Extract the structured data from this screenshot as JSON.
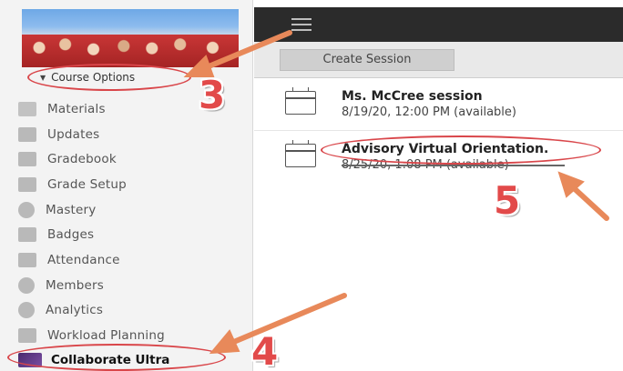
{
  "sidebar": {
    "course_options_label": "Course Options",
    "items": [
      {
        "label": "Materials",
        "icon": "materials-icon"
      },
      {
        "label": "Updates",
        "icon": "updates-icon"
      },
      {
        "label": "Gradebook",
        "icon": "gradebook-icon"
      },
      {
        "label": "Grade Setup",
        "icon": "grade-setup-icon"
      },
      {
        "label": "Mastery",
        "icon": "mastery-icon"
      },
      {
        "label": "Badges",
        "icon": "badges-icon"
      },
      {
        "label": "Attendance",
        "icon": "attendance-icon"
      },
      {
        "label": "Members",
        "icon": "members-icon"
      },
      {
        "label": "Analytics",
        "icon": "analytics-icon"
      },
      {
        "label": "Workload Planning",
        "icon": "workload-planning-icon"
      }
    ],
    "collaborate_label": "Collaborate Ultra"
  },
  "toolbar": {
    "create_session_label": "Create Session"
  },
  "sessions": [
    {
      "name": "Ms. McCree session",
      "when": "8/19/20, 12:00 PM (available)"
    },
    {
      "name": "Advisory Virtual Orientation.",
      "when": "8/25/20, 1:08 PM (available)"
    }
  ],
  "annotations": {
    "step_3": "3",
    "step_4": "4",
    "step_5": "5",
    "color": "#e24a4a",
    "arrow_color": "#e8895a"
  }
}
